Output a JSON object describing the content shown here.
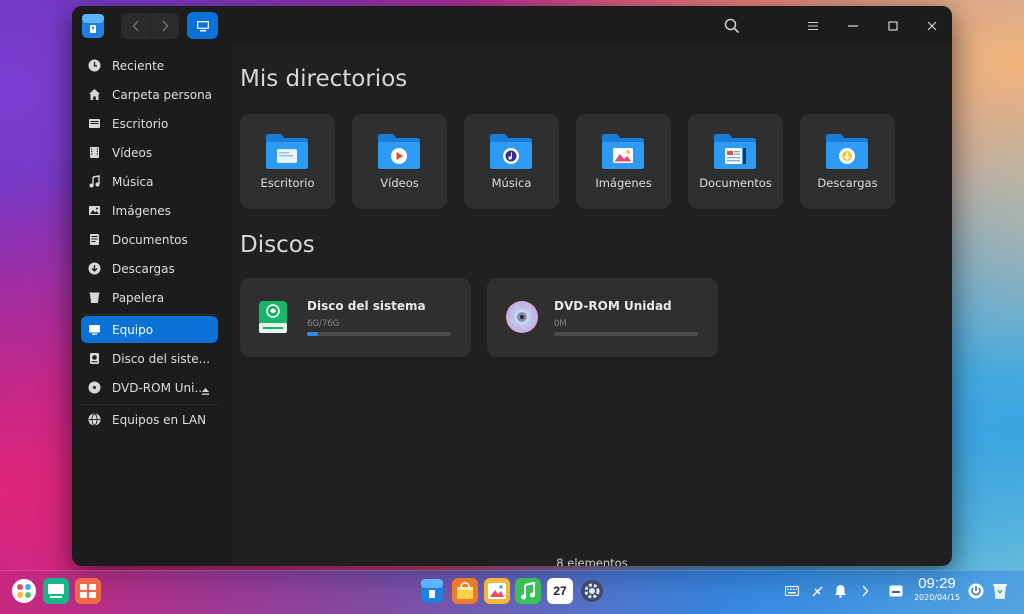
{
  "sidebar": {
    "items": [
      {
        "label": "Reciente",
        "icon": "clock-icon"
      },
      {
        "label": "Carpeta personal",
        "icon": "home-icon"
      },
      {
        "label": "Escritorio",
        "icon": "desktop-icon"
      },
      {
        "label": "Vídeos",
        "icon": "video-icon"
      },
      {
        "label": "Música",
        "icon": "music-icon"
      },
      {
        "label": "Imágenes",
        "icon": "image-icon"
      },
      {
        "label": "Documentos",
        "icon": "document-icon"
      },
      {
        "label": "Descargas",
        "icon": "download-icon"
      },
      {
        "label": "Papelera",
        "icon": "trash-icon"
      },
      {
        "label": "Equipo",
        "icon": "computer-icon",
        "active": true
      },
      {
        "label": "Disco del siste...",
        "icon": "disk-icon"
      },
      {
        "label": "DVD-ROM Uni...",
        "icon": "dvd-icon"
      },
      {
        "label": "Equipos en LAN",
        "icon": "network-icon"
      }
    ]
  },
  "main": {
    "directories_title": "Mis directorios",
    "folders": [
      {
        "label": "Escritorio"
      },
      {
        "label": "Vídeos"
      },
      {
        "label": "Música"
      },
      {
        "label": "Imágenes"
      },
      {
        "label": "Documentos"
      },
      {
        "label": "Descargas"
      }
    ],
    "disks_title": "Discos",
    "disks": [
      {
        "name": "Disco del sistema",
        "size": "6G/76G",
        "usage_fraction": 0.079
      },
      {
        "name": "DVD-ROM Unidad",
        "size": "0M",
        "usage_fraction": 0
      }
    ],
    "status": "8 elementos"
  },
  "taskbar": {
    "time": "09:29",
    "date": "2020/04/15",
    "calendar_day": "27"
  },
  "colors": {
    "accent": "#0a72d6",
    "folder": "#1e8ef0",
    "window_bg": "#202020",
    "sidebar_bg": "#1c1c1c",
    "tile_bg": "#2f2f2f"
  }
}
